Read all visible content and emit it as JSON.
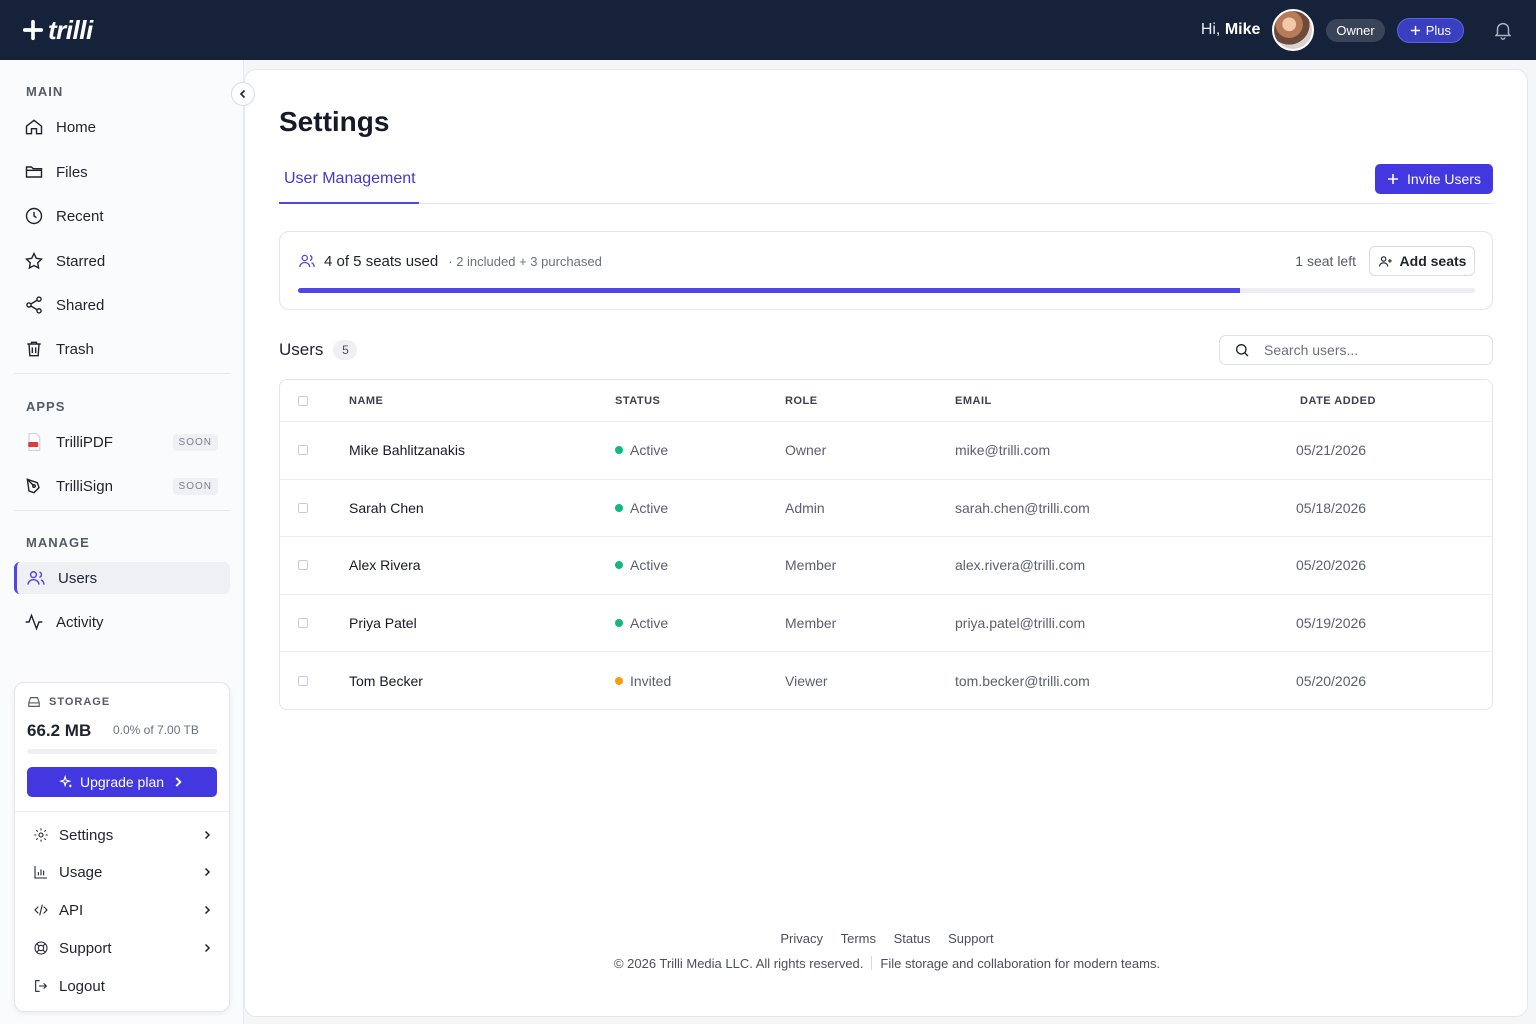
{
  "brand": {
    "name": "trilli"
  },
  "topbar": {
    "greeting_prefix": "Hi,",
    "user_name": "Mike",
    "role_badge": "Owner",
    "plan_badge": "Plus"
  },
  "sidebar": {
    "main_label": "MAIN",
    "main_items": [
      {
        "label": "Home",
        "icon": "home-icon"
      },
      {
        "label": "Files",
        "icon": "folder-icon"
      },
      {
        "label": "Recent",
        "icon": "clock-icon"
      },
      {
        "label": "Starred",
        "icon": "star-icon"
      },
      {
        "label": "Shared",
        "icon": "share-icon"
      },
      {
        "label": "Trash",
        "icon": "trash-icon"
      }
    ],
    "apps_label": "APPS",
    "app_items": [
      {
        "label": "TrilliPDF",
        "badge": "SOON",
        "icon": "pdf-icon"
      },
      {
        "label": "TrilliSign",
        "badge": "SOON",
        "icon": "pen-icon"
      }
    ],
    "manage_label": "MANAGE",
    "manage_items": [
      {
        "label": "Users",
        "icon": "users-icon",
        "active": true
      },
      {
        "label": "Activity",
        "icon": "activity-icon"
      }
    ],
    "storage": {
      "label": "STORAGE",
      "used": "66.2 MB",
      "percent_text": "0.0% of 7.00 TB",
      "fill_fraction": 0.0,
      "upgrade_label": "Upgrade plan"
    },
    "menu": [
      {
        "label": "Settings",
        "icon": "gear-icon"
      },
      {
        "label": "Usage",
        "icon": "bar-chart-icon"
      },
      {
        "label": "API",
        "icon": "code-icon"
      },
      {
        "label": "Support",
        "icon": "lifebuoy-icon"
      },
      {
        "label": "Logout",
        "icon": "logout-icon"
      }
    ]
  },
  "main": {
    "title": "Settings",
    "tab": "User Management",
    "invite_label": "Invite Users",
    "seats": {
      "summary": "4 of 5 seats used",
      "detail": "· 2 included + 3 purchased",
      "left_text": "1 seat left",
      "add_label": "Add seats",
      "used": 4,
      "total": 5
    },
    "users": {
      "title": "Users",
      "count": "5",
      "search_placeholder": "Search users..."
    },
    "table": {
      "headers": {
        "name": "NAME",
        "status": "STATUS",
        "role": "ROLE",
        "email": "EMAIL",
        "date": "DATE ADDED"
      },
      "rows": [
        {
          "name": "Mike Bahlitzanakis",
          "status": "Active",
          "status_color": "#10b981",
          "role": "Owner",
          "email": "mike@trilli.com",
          "date": "05/21/2026"
        },
        {
          "name": "Sarah Chen",
          "status": "Active",
          "status_color": "#10b981",
          "role": "Admin",
          "email": "sarah.chen@trilli.com",
          "date": "05/18/2026"
        },
        {
          "name": "Alex Rivera",
          "status": "Active",
          "status_color": "#10b981",
          "role": "Member",
          "email": "alex.rivera@trilli.com",
          "date": "05/20/2026"
        },
        {
          "name": "Priya Patel",
          "status": "Active",
          "status_color": "#10b981",
          "role": "Member",
          "email": "priya.patel@trilli.com",
          "date": "05/19/2026"
        },
        {
          "name": "Tom Becker",
          "status": "Invited",
          "status_color": "#f59e0b",
          "role": "Viewer",
          "email": "tom.becker@trilli.com",
          "date": "05/20/2026"
        }
      ]
    },
    "footer": {
      "links": [
        "Privacy",
        "Terms",
        "Status",
        "Support"
      ],
      "copyright": "© 2026 Trilli Media LLC. All rights reserved.",
      "tagline": "File storage and collaboration for modern teams."
    }
  },
  "colors": {
    "accent": "#4f46e5",
    "topbar": "#16223a",
    "active": "#10b981",
    "invited": "#f59e0b"
  }
}
